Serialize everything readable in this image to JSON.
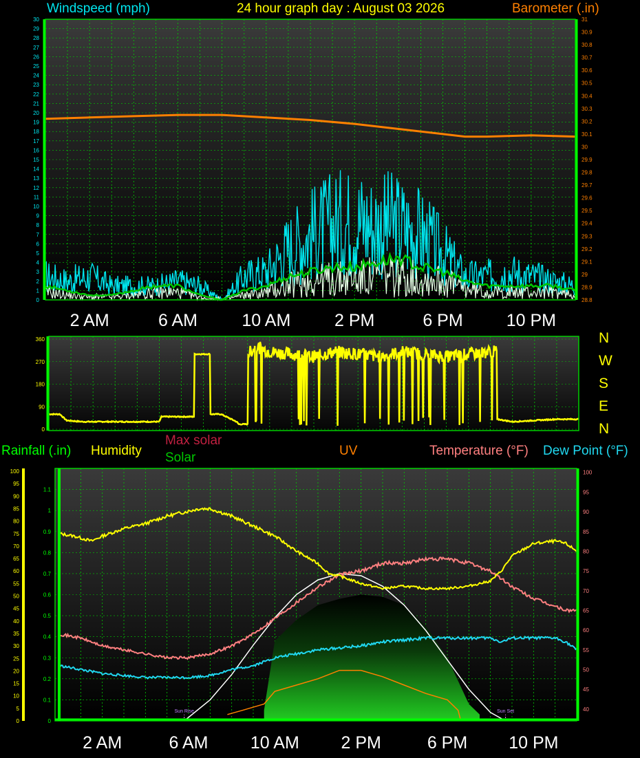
{
  "header": {
    "wind_label": "Windspeed (mph)",
    "title": "24 hour graph day : August 03 2026",
    "baro_label": "Barometer (.in)"
  },
  "bottom_labels": {
    "rainfall": "Rainfall (.in)",
    "humidity": "Humidity",
    "max_solar": "Max solar",
    "solar": "Solar",
    "uv": "UV",
    "temperature": "Temperature (°F)",
    "dew_point": "Dew Point (°F)",
    "sun_rise": "Sun Rise",
    "sun_set": "Sun Set"
  },
  "compass": [
    "N",
    "W",
    "S",
    "E",
    "N"
  ],
  "colors": {
    "wind_gust": "#00e5ee",
    "wind_avg": "#00c800",
    "wind_speed": "#e6ffe6",
    "barometer": "#ff8000",
    "direction": "#ffff00",
    "humidity": "#ffff00",
    "temperature": "#ff8080",
    "dew_point": "#20d8f0",
    "uv": "#ff8000",
    "max_solar": "#ffffff",
    "rainfall": "#00ff00",
    "grid": "#00d000"
  },
  "chart_data": [
    {
      "type": "line",
      "x_tick_labels": [
        "2 AM",
        "6 AM",
        "10 AM",
        "2 PM",
        "6 PM",
        "10 PM"
      ],
      "x_range_hours": [
        0,
        24
      ],
      "grid": true,
      "left_axis": {
        "ylim": [
          0,
          30
        ],
        "ticks": [
          "0",
          "1",
          "2",
          "3",
          "4",
          "5",
          "6",
          "7",
          "8",
          "9",
          "10",
          "11",
          "12",
          "13",
          "14",
          "15",
          "16",
          "17",
          "18",
          "19",
          "20",
          "21",
          "22",
          "23",
          "24",
          "25",
          "26",
          "27",
          "28",
          "29",
          "30"
        ]
      },
      "right_axis": {
        "ylim": [
          28.8,
          31.0
        ],
        "ticks": [
          "28.8",
          "28.9",
          "29",
          "29.1",
          "29.2",
          "29.3",
          "29.4",
          "29.5",
          "29.6",
          "29.7",
          "29.8",
          "29.9",
          "30",
          "30.1",
          "30.2",
          "30.3",
          "30.4",
          "30.5",
          "30.6",
          "30.7",
          "30.8",
          "30.9",
          "31"
        ]
      },
      "series": [
        {
          "key": "barometer",
          "axis": "right",
          "x": [
            0,
            2,
            4,
            6,
            8,
            10,
            12,
            14,
            16,
            18,
            19,
            20,
            22,
            24
          ],
          "y": [
            30.22,
            30.23,
            30.24,
            30.25,
            30.25,
            30.23,
            30.21,
            30.18,
            30.14,
            30.1,
            30.08,
            30.08,
            30.09,
            30.08
          ]
        },
        {
          "key": "wind_gust",
          "axis": "left",
          "x": [
            0,
            1,
            2,
            3,
            4,
            5,
            6,
            7,
            8,
            9,
            10,
            11,
            12,
            13,
            14,
            15,
            16,
            17,
            18,
            19,
            20,
            21,
            22,
            23,
            24
          ],
          "y": [
            2.5,
            2,
            2.5,
            1.5,
            1.5,
            1.5,
            2,
            1.5,
            0,
            2.5,
            3,
            5.5,
            7,
            8,
            8.5,
            8,
            8,
            7,
            5,
            2.5,
            2.5,
            3,
            2.5,
            2,
            1.5
          ]
        },
        {
          "key": "wind_avg",
          "axis": "left",
          "x": [
            0,
            1,
            2,
            3,
            4,
            5,
            6,
            7,
            8,
            9,
            10,
            11,
            12,
            13,
            14,
            15,
            16,
            17,
            18,
            19,
            20,
            21,
            22,
            23,
            24
          ],
          "y": [
            1.5,
            1,
            0.5,
            0.5,
            1,
            1.5,
            1.5,
            0.5,
            0,
            1,
            1.5,
            2.5,
            3,
            3.5,
            3.5,
            4,
            4.5,
            3.5,
            3,
            2,
            1.5,
            1.5,
            1.5,
            1.5,
            1
          ]
        },
        {
          "key": "wind_speed",
          "axis": "left",
          "x": [
            0,
            1,
            2,
            3,
            4,
            5,
            6,
            7,
            8,
            9,
            10,
            11,
            12,
            13,
            14,
            15,
            16,
            17,
            18,
            19,
            20,
            21,
            22,
            23,
            24
          ],
          "y": [
            0.8,
            0.5,
            0.3,
            0.3,
            0.5,
            0.8,
            0.8,
            0.3,
            0,
            0.5,
            0.8,
            1.5,
            2,
            2.2,
            2.2,
            2.5,
            2.5,
            2.2,
            2,
            1.2,
            0.8,
            0.8,
            0.8,
            0.8,
            0.5
          ]
        }
      ]
    },
    {
      "type": "line",
      "ylim": [
        0,
        360
      ],
      "y_ticks": [
        "0",
        "90",
        "180",
        "270",
        "360"
      ],
      "x_range_hours": [
        0,
        24
      ],
      "grid": true,
      "series": [
        {
          "key": "direction",
          "x": [
            0,
            0.5,
            0.8,
            1.5,
            3,
            5,
            5.1,
            6.5,
            6.6,
            7.2,
            7.3,
            7.8,
            8.5,
            8.6,
            9.0,
            9.4,
            10,
            11,
            12,
            13,
            14,
            15,
            16,
            17,
            18,
            19,
            20,
            20.3,
            21,
            22,
            23,
            24
          ],
          "y": [
            60,
            60,
            35,
            30,
            30,
            30,
            50,
            50,
            300,
            300,
            60,
            60,
            30,
            20,
            300,
            330,
            310,
            300,
            290,
            310,
            300,
            290,
            310,
            300,
            290,
            300,
            310,
            40,
            30,
            35,
            40,
            40
          ]
        }
      ]
    },
    {
      "type": "line",
      "x_tick_labels": [
        "2 AM",
        "6 AM",
        "10 AM",
        "2 PM",
        "6 PM",
        "10 PM"
      ],
      "x_range_hours": [
        0,
        24
      ],
      "grid": true,
      "left_outer_axis": {
        "label": "Humidity",
        "ylim": [
          0,
          100
        ],
        "ticks": [
          "0",
          "5",
          "10",
          "15",
          "20",
          "25",
          "30",
          "35",
          "40",
          "45",
          "50",
          "55",
          "60",
          "65",
          "70",
          "75",
          "80",
          "85",
          "90",
          "95",
          "100"
        ]
      },
      "left_inner_axis": {
        "label": "Rainfall (.in)",
        "ylim": [
          0,
          1.2
        ],
        "ticks": [
          "0",
          "0.1",
          "0.2",
          "0.3",
          "0.4",
          "0.5",
          "0.6",
          "0.7",
          "0.8",
          "0.9",
          "1",
          "1.1"
        ]
      },
      "right_axis": {
        "label": "Temperature (°F)",
        "ylim": [
          37,
          101
        ],
        "ticks": [
          "40",
          "45",
          "50",
          "55",
          "60",
          "65",
          "70",
          "75",
          "80",
          "85",
          "90",
          "95",
          "100"
        ]
      },
      "events": [
        {
          "label": "Sun Rise",
          "hour": 5.8
        },
        {
          "label": "Sun Set",
          "hour": 20.7
        }
      ],
      "series": [
        {
          "key": "humidity",
          "axis": "left_outer",
          "x": [
            0,
            0.7,
            1.5,
            2,
            3,
            4,
            5,
            5.5,
            6,
            6.5,
            7,
            8,
            9,
            10,
            11,
            12,
            12.5,
            13,
            14,
            15,
            16,
            17,
            18,
            19,
            19.5,
            20,
            20.5,
            21,
            22,
            23,
            23.5,
            24
          ],
          "y": [
            75,
            74,
            72,
            74,
            77,
            79,
            82,
            83,
            84,
            85,
            85,
            82,
            78,
            74,
            68,
            63,
            59,
            58,
            55,
            53,
            54,
            53,
            53,
            54,
            55,
            56,
            60,
            66,
            71,
            72,
            71,
            68
          ]
        },
        {
          "key": "temperature",
          "axis": "right",
          "x": [
            0,
            1,
            2,
            3,
            4,
            5,
            6,
            7,
            8,
            9,
            10,
            11,
            12,
            13,
            14,
            15,
            16,
            17,
            18,
            19,
            20,
            21,
            22,
            23,
            23.5,
            24
          ],
          "y": [
            59,
            58,
            56,
            55,
            54,
            53,
            53,
            54,
            56,
            59,
            63,
            67,
            71,
            74,
            75,
            77,
            77,
            78,
            78,
            77,
            75,
            71,
            68,
            66,
            65,
            65
          ]
        },
        {
          "key": "dew_point",
          "axis": "right",
          "x": [
            0,
            1,
            2,
            3,
            4,
            5,
            6,
            7,
            8,
            9,
            10,
            11,
            12,
            13,
            14,
            15,
            16,
            17,
            18,
            19,
            20,
            20.5,
            21,
            22,
            23,
            23.5,
            24
          ],
          "y": [
            51,
            50,
            49,
            48.5,
            48,
            48,
            48,
            48.5,
            50,
            51,
            53,
            54,
            55,
            55.5,
            56,
            57,
            57.5,
            58,
            58,
            58,
            58,
            57,
            58,
            58,
            58,
            57,
            55
          ]
        },
        {
          "key": "max_solar",
          "axis": "left_inner",
          "x": [
            5.8,
            7,
            8,
            9,
            10,
            11,
            12,
            13,
            14,
            15,
            16,
            17,
            18,
            19,
            20,
            20.7
          ],
          "y": [
            0,
            0.1,
            0.22,
            0.36,
            0.49,
            0.6,
            0.67,
            0.7,
            0.69,
            0.64,
            0.55,
            0.43,
            0.29,
            0.15,
            0.04,
            0
          ]
        },
        {
          "key": "solar",
          "axis": "left_inner",
          "x": [
            9.5,
            10,
            11,
            12,
            13,
            14,
            15,
            16,
            17,
            18,
            19,
            19.5
          ],
          "y": [
            0.05,
            0.38,
            0.48,
            0.55,
            0.58,
            0.6,
            0.59,
            0.55,
            0.45,
            0.3,
            0.08,
            0.03
          ]
        },
        {
          "key": "uv",
          "axis": "left_inner",
          "x": [
            7.8,
            8.5,
            9.5,
            10,
            11,
            12,
            13,
            14,
            15,
            16,
            17,
            18,
            18.5,
            18.6
          ],
          "y": [
            0.03,
            0.05,
            0.08,
            0.14,
            0.17,
            0.2,
            0.24,
            0.24,
            0.21,
            0.17,
            0.13,
            0.1,
            0.05,
            0.01
          ]
        },
        {
          "key": "rainfall",
          "axis": "left_inner",
          "x": [
            0,
            24
          ],
          "y": [
            0,
            0
          ]
        }
      ]
    }
  ]
}
